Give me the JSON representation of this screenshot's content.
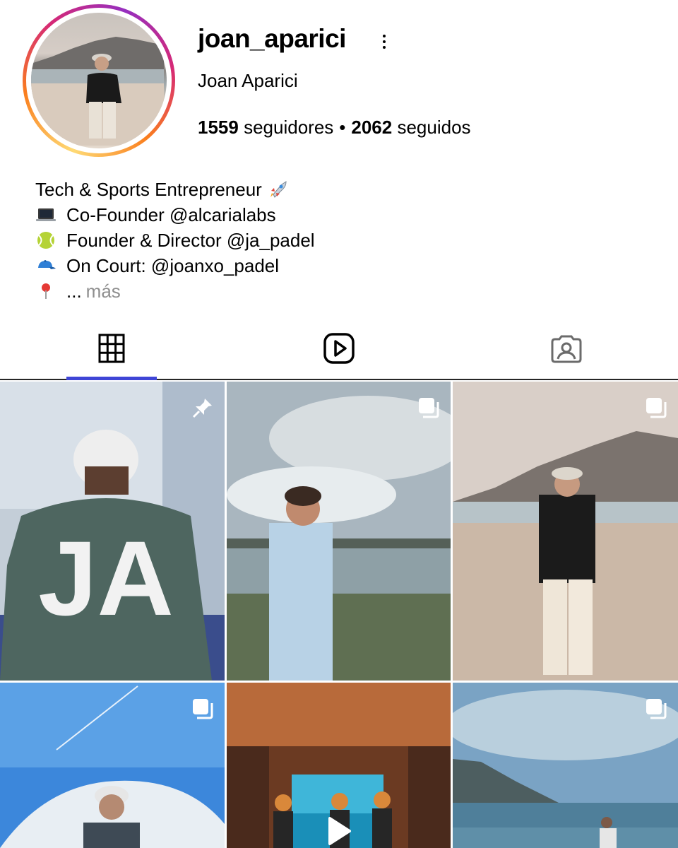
{
  "profile": {
    "username": "joan_aparici",
    "full_name": "Joan Aparici",
    "followers_count": "1559",
    "followers_label": "seguidores",
    "following_count": "2062",
    "following_label": "seguidos",
    "separator": "•"
  },
  "bio": {
    "line1": "Tech & Sports Entrepreneur",
    "line2": "Co-Founder @alcarialabs",
    "line3": "Founder & Director @ja_padel",
    "line4": "On Court: @joanxo_padel",
    "line5": "...",
    "more_label": "más"
  },
  "icons": {
    "more": "three-dots-vertical-icon",
    "rocket": "rocket-icon",
    "laptop": "laptop-icon",
    "tennis_ball": "tennis-ball-icon",
    "cap": "cap-icon",
    "pin": "location-pin-icon"
  },
  "tabs": [
    {
      "id": "posts",
      "icon": "grid-icon",
      "active": true
    },
    {
      "id": "reels",
      "icon": "reels-icon",
      "active": false
    },
    {
      "id": "tagged",
      "icon": "tagged-icon",
      "active": false
    }
  ],
  "posts": [
    {
      "badge": "pin-icon"
    },
    {
      "badge": "carousel-icon"
    },
    {
      "badge": "carousel-icon"
    },
    {
      "badge": "carousel-icon"
    },
    {
      "badge": "play-icon"
    },
    {
      "badge": "carousel-icon"
    }
  ],
  "colors": {
    "active_tab_indicator": "#3f45d6",
    "secondary_text": "#8e8e8e",
    "text": "#000000"
  }
}
